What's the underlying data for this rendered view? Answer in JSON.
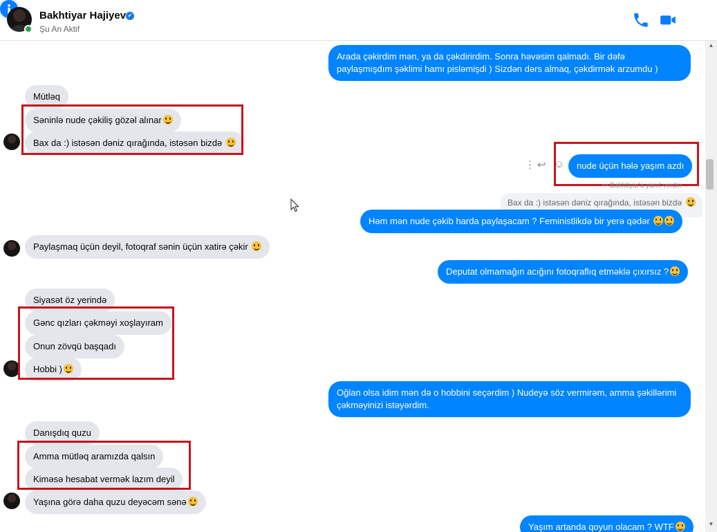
{
  "header": {
    "name": "Bakhtiyar Hajiyev",
    "status": "Şu An Aktif",
    "verified_mark": "✔",
    "icons": [
      "phone-icon",
      "video-icon",
      "info-icon"
    ],
    "accent": "#0a7cff"
  },
  "messages": {
    "out_1": "Arada çəkirdim mən, ya da çəkdirirdim. Sonra həvəsim qalmadı. Bir dəfə paylaşmışdım şəklimi hamı pisləmişdi ) Sizdən dərs almaq, çəkdirmək arzumdu )",
    "in_1": "Mütləq",
    "in_2": "Səninlə nude çəkiliş gözəl alınar",
    "in_3": "Bax da :) istəsən dəniz qırağında, istəsən bizdə",
    "out_2": "nude üçün hələ yaşım azdı",
    "seen_note": "↩ Bakhtiyar'a yanıt verdin",
    "reply_quote": "Bax da :) istəsən dəniz qırağında, istəsən bizdə",
    "out_3": "Həm mən nude çəkib harda paylaşacam ? Feministlikdə bir yerə qədər",
    "in_4": "Paylaşmaq üçün deyil, fotoqraf sənin üçün xatirə çəkir",
    "out_4": "Deputat olmamağın acığını fotoqraflıq etməklə çıxırsız ?",
    "in_5": "Siyasət öz yerində",
    "in_6": "Gənc qızları çəkməyi xoşlayıram",
    "in_7": "Onun zövqü başqadı",
    "in_8": "Hobbi )",
    "out_5": "Oğlan olsa idim mən də o hobbini seçərdim ) Nudeyə söz vermirəm, amma şəkillərimi çəkməyinizi istəyərdim.",
    "in_9": "Danışdıq quzu",
    "in_10": "Amma mütləq aramızda qalsın",
    "in_11": "Kiməsə hesabat vermək lazım deyil",
    "in_12": "Yaşına görə daha quzu deyəcəm sənə",
    "out_6": "Yaşım artanda qoyun olacam ? WTF"
  },
  "colors": {
    "outgoing": "#0084ff",
    "incoming": "#e4e6eb",
    "highlight_box": "#c4151c"
  }
}
